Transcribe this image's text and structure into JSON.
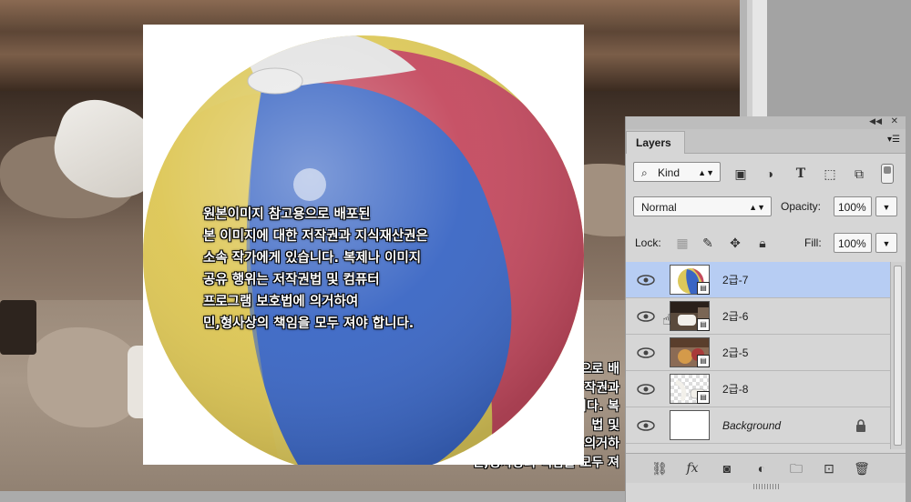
{
  "canvas": {
    "notice_lines": [
      "원본이미지 참고용으로 배포된",
      "본 이미지에 대한 저작권과 지식재산권은",
      "소속 작가에게 있습니다. 복제나 이미지",
      "공유 행위는 저작권법 및 컴퓨터",
      "프로그램 보호법에 의거하여",
      "민,형사상의 책임을 모두 져야 합니다."
    ],
    "notice_partial_lines": [
      "으로 배",
      "작권과",
      "니다. 복",
      "법 및",
      "의거하",
      "민,형사상의 책임을 모두 져"
    ]
  },
  "colors": {
    "ball_red": "#c44a5f",
    "ball_blue": "#3a66c4",
    "ball_yellow": "#dcc85a",
    "ball_white": "#e3e3e3",
    "selection": "#b7cdf3"
  },
  "layers_panel": {
    "tab": "Layers",
    "filter_kind": "Kind",
    "blend_mode": "Normal",
    "opacity_label": "Opacity:",
    "opacity_value": "100%",
    "lock_label": "Lock:",
    "fill_label": "Fill:",
    "fill_value": "100%",
    "layers": [
      {
        "name": "2급-7",
        "selected": true
      },
      {
        "name": "2급-6",
        "selected": false
      },
      {
        "name": "2급-5",
        "selected": false
      },
      {
        "name": "2급-8",
        "selected": false
      },
      {
        "name": "Background",
        "selected": false,
        "locked": true
      }
    ],
    "icons": {
      "filter": "search-icon",
      "pixel": "image-filter-icon",
      "adjust": "adjustment-filter-icon",
      "type": "type-filter-icon",
      "shape": "shape-filter-icon",
      "smart": "smart-object-filter-icon",
      "bottom": [
        "link-icon",
        "fx-icon",
        "mask-icon",
        "adjustment-icon",
        "folder-icon",
        "new-layer-icon",
        "trash-icon"
      ]
    },
    "fx_label": "fx"
  }
}
